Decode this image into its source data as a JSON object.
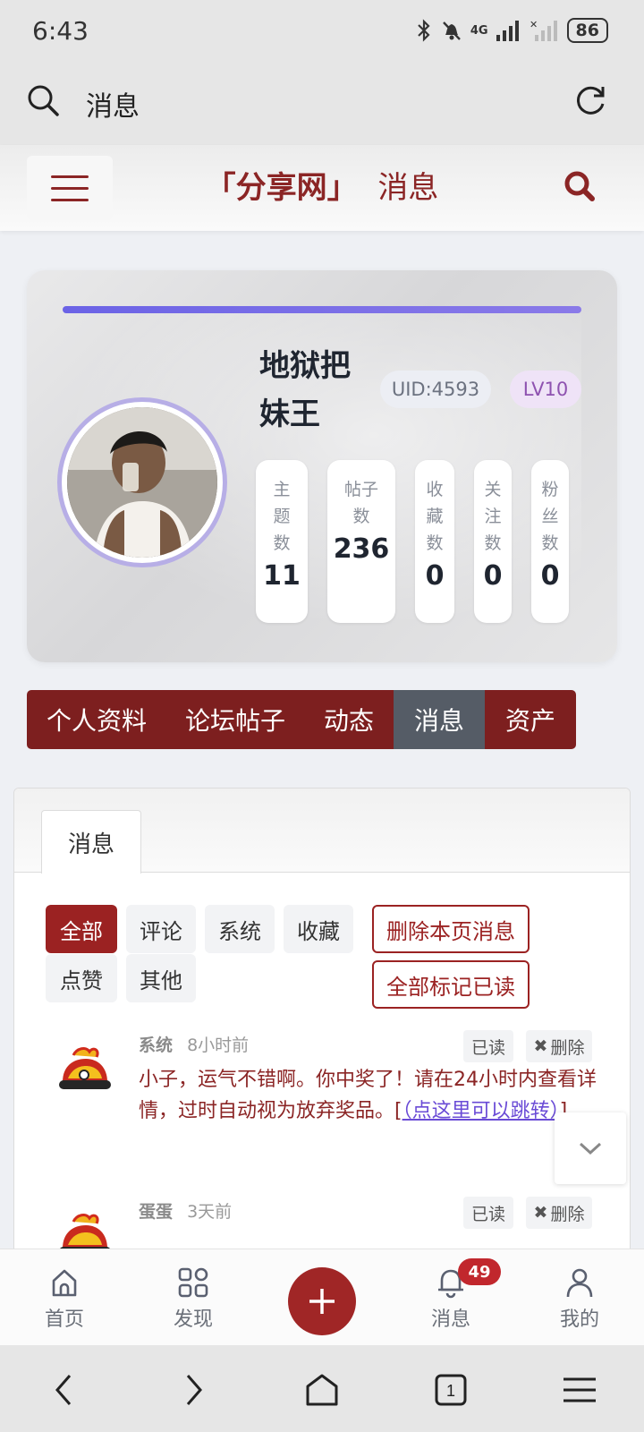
{
  "status_bar": {
    "time": "6:43",
    "battery": "86",
    "network": "4G"
  },
  "browser": {
    "query": "消息"
  },
  "site": {
    "brand": "「分享网」",
    "page": "消息"
  },
  "profile": {
    "name_line1": "地狱把",
    "name_line2": "妹王",
    "uid": "UID:4593",
    "level": "LV10",
    "stats": [
      {
        "label": [
          "主",
          "题",
          "数"
        ],
        "value": "11"
      },
      {
        "label": [
          "帖子",
          "数"
        ],
        "value": "236"
      },
      {
        "label": [
          "收",
          "藏",
          "数"
        ],
        "value": "0"
      },
      {
        "label": [
          "关",
          "注",
          "数"
        ],
        "value": "0"
      },
      {
        "label": [
          "粉",
          "丝",
          "数"
        ],
        "value": "0"
      }
    ]
  },
  "tabs": [
    "个人资料",
    "论坛帖子",
    "动态",
    "消息",
    "资产"
  ],
  "messages_panel": {
    "tab_label": "消息",
    "filters": [
      "全部",
      "评论",
      "系统",
      "收藏",
      "点赞",
      "其他"
    ],
    "actions": {
      "delete_page": "删除本页消息",
      "mark_all_read": "全部标记已读"
    },
    "items": [
      {
        "sender": "系统",
        "time": "8小时前",
        "read": "已读",
        "delete": "删除",
        "text": "小子，运气不错啊。你中奖了！请在24小时内查看详情，过时自动视为放弃奖品。[",
        "link": "（点这里可以跳转）",
        "text_end": "]"
      },
      {
        "sender": "蛋蛋",
        "time": "3天前",
        "read": "已读",
        "delete": "删除"
      }
    ]
  },
  "bottom_nav": {
    "home": "首页",
    "discover": "发现",
    "messages": "消息",
    "messages_badge": "49",
    "mine": "我的"
  },
  "colors": {
    "brand": "#8b2525",
    "accent": "#6b63e6",
    "active_tab": "#555c66"
  }
}
